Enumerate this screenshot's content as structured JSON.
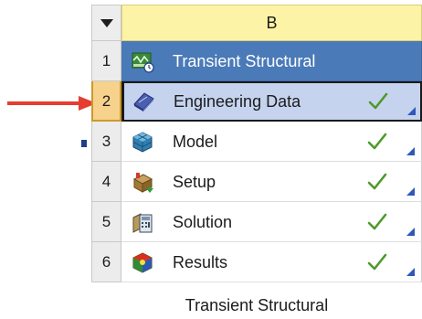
{
  "header": {
    "column_letter": "B"
  },
  "system_name": "Transient Structural",
  "rows": [
    {
      "num": "1",
      "label": "Transient Structural",
      "icon": "transient-structural-icon",
      "status": ""
    },
    {
      "num": "2",
      "label": "Engineering Data",
      "icon": "engineering-data-icon",
      "status": "check"
    },
    {
      "num": "3",
      "label": "Model",
      "icon": "model-icon",
      "status": "check"
    },
    {
      "num": "4",
      "label": "Setup",
      "icon": "setup-icon",
      "status": "check"
    },
    {
      "num": "5",
      "label": "Solution",
      "icon": "solution-icon",
      "status": "check"
    },
    {
      "num": "6",
      "label": "Results",
      "icon": "results-icon",
      "status": "check"
    }
  ],
  "colors": {
    "header_bg": "#fcf3a6",
    "title_bg": "#4a7ab8",
    "selected_bg": "#c6d3ef",
    "selected_num_bg": "#f7d28d",
    "check": "#4e9a2a",
    "arrow": "#e53d2f"
  }
}
